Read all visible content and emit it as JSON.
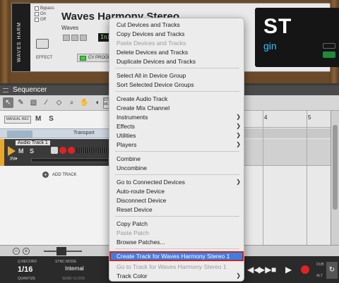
{
  "device": {
    "title": "Waves Harmony Stereo",
    "subtitle": "Waves",
    "patch": "Init Pat",
    "brand_vertical": "WAVES HARM",
    "effect_label": "EFFECT",
    "cv_programmer": "CV PROGRAMMER",
    "check1": "Bypass",
    "check2": "On",
    "check3": "Off",
    "display_big": "ST",
    "display_sub": "gin"
  },
  "sequencer": {
    "title": "Sequencer",
    "edit_label": "EDIT MODE",
    "manual_rec": "MANUAL REC",
    "ms": "M S",
    "transport_label": "Transport",
    "audio_track_name": "Audio Track 1",
    "audio_ms": "M S",
    "in_label": "IN▾",
    "add_track": "ADD TRACK",
    "ruler": [
      "4",
      "5"
    ]
  },
  "transport": {
    "quantize_top": "Q RECORD",
    "quantize_value": "1/16",
    "quantize_bottom": "QUANTIZE",
    "sync_mode": "SYNC MODE",
    "sync_value": "Internal",
    "send_clock": "SEND CLOCK",
    "dub": "DUB",
    "alt": "ALT",
    "loop_icon": "loop"
  },
  "menu": {
    "items": [
      "Cut Devices and Tracks",
      "Copy Devices and Tracks",
      "Paste Devices and Tracks",
      "Delete Devices and Tracks",
      "Duplicate Devices and Tracks",
      "Select All in Device Group",
      "Sort Selected Device Groups",
      "Create Audio Track",
      "Create Mix Channel",
      "Instruments",
      "Effects",
      "Utilities",
      "Players",
      "Combine",
      "Uncombine",
      "Go to Connected Devices",
      "Auto-route Device",
      "Disconnect Device",
      "Reset Device",
      "Copy Patch",
      "Paste Patch",
      "Browse Patches...",
      "Create Track for Waves Harmony Stereo 1",
      "Go to Track for Waves Harmony Stereo 1",
      "Track Color"
    ]
  },
  "colors": {
    "menu_highlight": "#3d7fe0",
    "highlight_border": "#d92020",
    "track_accent": "#e7a72e",
    "record_red": "#e02222"
  }
}
